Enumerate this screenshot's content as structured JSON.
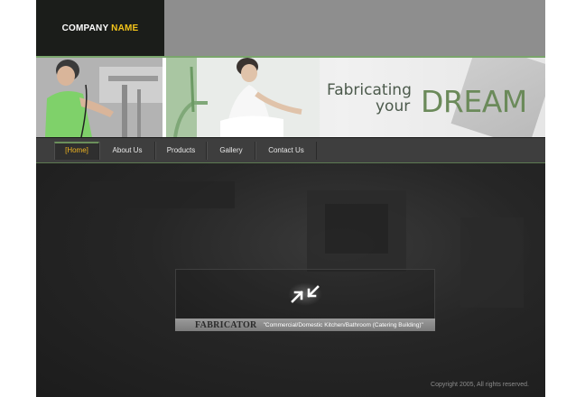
{
  "header": {
    "logo_primary": "COMPANY",
    "logo_accent": "NAME"
  },
  "banner": {
    "tagline_line1": "Fabricating",
    "tagline_line2": "your",
    "tagline_big": "DREAM"
  },
  "nav": {
    "items": [
      {
        "label": "[Home]"
      },
      {
        "label": "About Us"
      },
      {
        "label": "Products"
      },
      {
        "label": "Gallery"
      },
      {
        "label": "Contact Us"
      }
    ]
  },
  "feature": {
    "icon": "collapse-arrows-icon",
    "title": "FABRICATOR",
    "description": "\"Commercial/Domestic Kitchen/Bathroom (Catering Building)\""
  },
  "footer": {
    "copyright": "Copyright 2005, All rights reserved."
  },
  "colors": {
    "accent_yellow": "#f2c31a",
    "accent_green": "#6b8a5a",
    "nav_active": "#f1b620",
    "background_dark": "#1a1a1a"
  }
}
